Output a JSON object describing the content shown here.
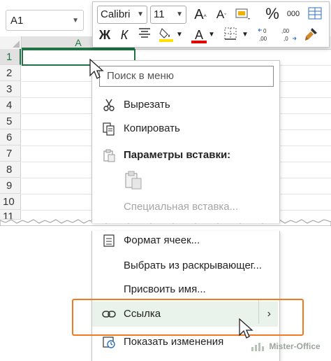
{
  "namebox": {
    "value": "A1"
  },
  "columns": [
    "A"
  ],
  "rows": [
    "1",
    "2",
    "3",
    "4",
    "5",
    "6",
    "7",
    "8",
    "9",
    "10",
    "11"
  ],
  "toolbar": {
    "font_name": "Calibri",
    "font_size": "11",
    "increase_font": "A",
    "decrease_font": "A",
    "percent": "%",
    "thousands": "000",
    "bold": "Ж",
    "italic": "К",
    "font_color": "A",
    "fill_color": "#ffe000",
    "font_color_hex": "#e00000"
  },
  "menu": {
    "search_placeholder": "Поиск в меню",
    "cut": "Вырезать",
    "copy": "Копировать",
    "paste_options": "Параметры вставки:",
    "paste_special": "Специальная вставка...",
    "format_cells": "Формат ячеек...",
    "pick_from_list": "Выбрать из раскрывающег...",
    "define_name": "Присвоить имя...",
    "link": "Ссылка",
    "show_changes": "Показать изменения",
    "submenu_arrow": "›"
  },
  "colors": {
    "excel_green": "#217346",
    "highlight_orange": "#f07a22"
  },
  "watermark": "Mister-Office"
}
